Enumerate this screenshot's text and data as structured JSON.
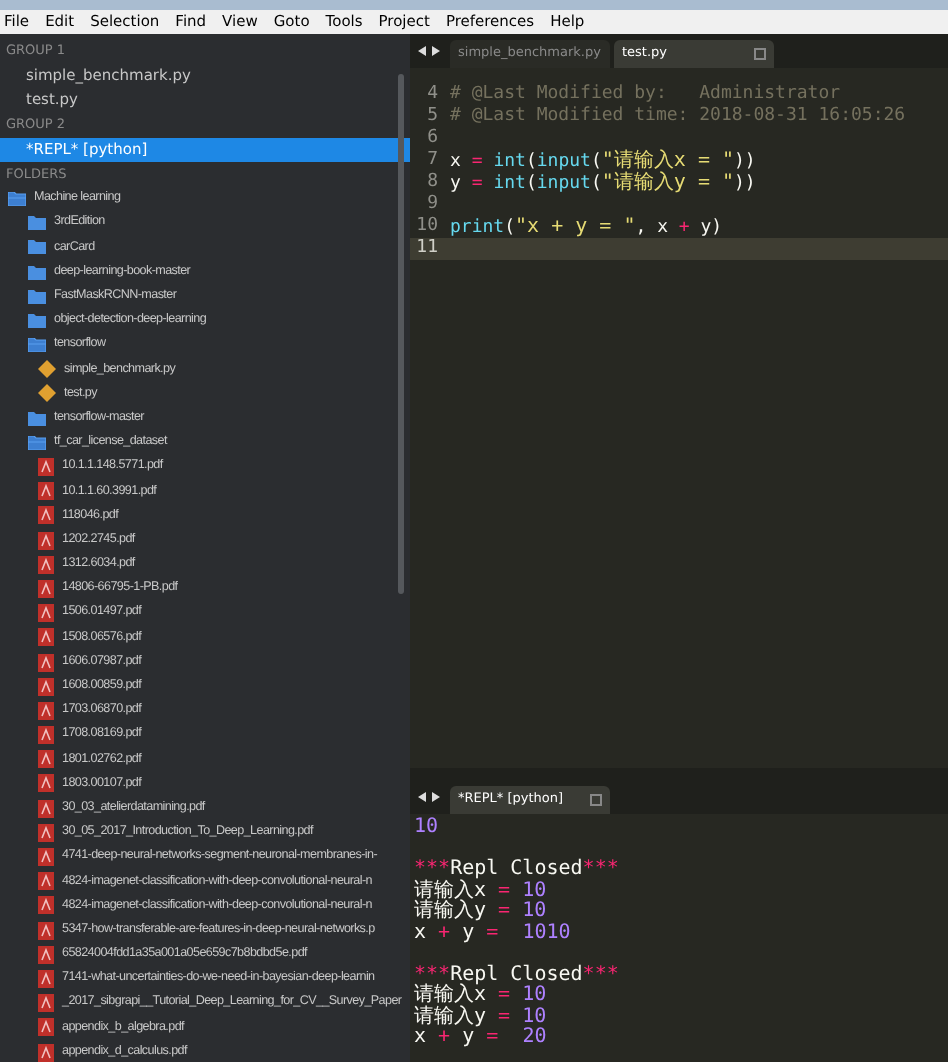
{
  "menu": [
    "File",
    "Edit",
    "Selection",
    "Find",
    "View",
    "Goto",
    "Tools",
    "Project",
    "Preferences",
    "Help"
  ],
  "sidebar": {
    "groups": [
      {
        "label": "GROUP 1",
        "files": [
          {
            "name": "simple_benchmark.py",
            "selected": false
          },
          {
            "name": "test.py",
            "selected": false
          }
        ]
      },
      {
        "label": "GROUP 2",
        "files": [
          {
            "name": "*REPL* [python]",
            "selected": true
          }
        ]
      }
    ],
    "folders_label": "FOLDERS",
    "tree": [
      {
        "name": "Machine learning",
        "kind": "folder",
        "expanded": true,
        "children": [
          {
            "name": "3rdEdition",
            "kind": "folder",
            "expanded": false
          },
          {
            "name": "carCard",
            "kind": "folder",
            "expanded": false
          },
          {
            "name": "deep-learning-book-master",
            "kind": "folder",
            "expanded": false
          },
          {
            "name": "FastMaskRCNN-master",
            "kind": "folder",
            "expanded": false
          },
          {
            "name": "object-detection-deep-learning",
            "kind": "folder",
            "expanded": false
          },
          {
            "name": "tensorflow",
            "kind": "folder",
            "expanded": true,
            "children": [
              {
                "name": "simple_benchmark.py",
                "kind": "py"
              },
              {
                "name": "test.py",
                "kind": "py"
              }
            ]
          },
          {
            "name": "tensorflow-master",
            "kind": "folder",
            "expanded": false
          },
          {
            "name": "tf_car_license_dataset",
            "kind": "folder",
            "expanded": true,
            "children": [
              {
                "name": "10.1.1.148.5771.pdf",
                "kind": "pdf"
              },
              {
                "name": "10.1.1.60.3991.pdf",
                "kind": "pdf"
              },
              {
                "name": "118046.pdf",
                "kind": "pdf"
              },
              {
                "name": "1202.2745.pdf",
                "kind": "pdf"
              },
              {
                "name": "1312.6034.pdf",
                "kind": "pdf"
              },
              {
                "name": "14806-66795-1-PB.pdf",
                "kind": "pdf"
              },
              {
                "name": "1506.01497.pdf",
                "kind": "pdf"
              },
              {
                "name": "1508.06576.pdf",
                "kind": "pdf"
              },
              {
                "name": "1606.07987.pdf",
                "kind": "pdf"
              },
              {
                "name": "1608.00859.pdf",
                "kind": "pdf"
              },
              {
                "name": "1703.06870.pdf",
                "kind": "pdf"
              },
              {
                "name": "1708.08169.pdf",
                "kind": "pdf"
              },
              {
                "name": "1801.02762.pdf",
                "kind": "pdf"
              },
              {
                "name": "1803.00107.pdf",
                "kind": "pdf"
              },
              {
                "name": "30_03_atelierdatamining.pdf",
                "kind": "pdf"
              },
              {
                "name": "30_05_2017_Introduction_To_Deep_Learning.pdf",
                "kind": "pdf"
              },
              {
                "name": "4741-deep-neural-networks-segment-neuronal-membranes-in-",
                "kind": "pdf"
              },
              {
                "name": "4824-imagenet-classification-with-deep-convolutional-neural-n",
                "kind": "pdf"
              },
              {
                "name": "4824-imagenet-classification-with-deep-convolutional-neural-n",
                "kind": "pdf"
              },
              {
                "name": "5347-how-transferable-are-features-in-deep-neural-networks.p",
                "kind": "pdf"
              },
              {
                "name": "65824004fdd1a35a001a05e659c7b8bdbd5e.pdf",
                "kind": "pdf"
              },
              {
                "name": "7141-what-uncertainties-do-we-need-in-bayesian-deep-learnin",
                "kind": "pdf"
              },
              {
                "name": "_2017_sibgrapi__Tutorial_Deep_Learning_for_CV__Survey_Paper",
                "kind": "pdf"
              },
              {
                "name": "appendix_b_algebra.pdf",
                "kind": "pdf"
              },
              {
                "name": "appendix_d_calculus.pdf",
                "kind": "pdf"
              }
            ]
          }
        ]
      }
    ]
  },
  "editor": {
    "tabs": [
      {
        "label": "simple_benchmark.py",
        "selected": false
      },
      {
        "label": "test.py",
        "selected": true
      }
    ],
    "lines": [
      {
        "number": "4",
        "current": false,
        "tokens": [
          {
            "kind": "comment",
            "text": "# @Last Modified by:   Administrator"
          }
        ]
      },
      {
        "number": "5",
        "current": false,
        "tokens": [
          {
            "kind": "comment",
            "text": "# @Last Modified time: 2018-08-31 16:05:26"
          }
        ]
      },
      {
        "number": "6",
        "current": false
      },
      {
        "number": "7",
        "current": false,
        "tokens": [
          {
            "kind": "plain",
            "text": "x "
          },
          {
            "kind": "operator",
            "text": "= "
          },
          {
            "kind": "builtin",
            "text": "int"
          },
          {
            "kind": "plain",
            "text": "("
          },
          {
            "kind": "builtin",
            "text": "input"
          },
          {
            "kind": "plain",
            "text": "("
          },
          {
            "kind": "string",
            "text": "\"请输入x = \""
          },
          {
            "kind": "plain",
            "text": "))"
          }
        ]
      },
      {
        "number": "8",
        "current": false,
        "tokens": [
          {
            "kind": "plain",
            "text": "y "
          },
          {
            "kind": "operator",
            "text": "= "
          },
          {
            "kind": "builtin",
            "text": "int"
          },
          {
            "kind": "plain",
            "text": "("
          },
          {
            "kind": "builtin",
            "text": "input"
          },
          {
            "kind": "plain",
            "text": "("
          },
          {
            "kind": "string",
            "text": "\"请输入y = \""
          },
          {
            "kind": "plain",
            "text": "))"
          }
        ]
      },
      {
        "number": "9",
        "current": false
      },
      {
        "number": "10",
        "current": false,
        "tokens": [
          {
            "kind": "builtin",
            "text": "print"
          },
          {
            "kind": "plain",
            "text": "("
          },
          {
            "kind": "string",
            "text": "\"x + y = \""
          },
          {
            "kind": "plain",
            "text": ", x "
          },
          {
            "kind": "operator",
            "text": "+ "
          },
          {
            "kind": "plain",
            "text": "y)"
          }
        ]
      },
      {
        "number": "11",
        "current": true
      }
    ]
  },
  "repl": {
    "tabs": [
      {
        "label": "*REPL* [python]",
        "selected": true
      }
    ],
    "lines": [
      {
        "kind": "output",
        "tokens": [
          {
            "kind": "number",
            "text": "10"
          }
        ]
      },
      {
        "kind": "banner",
        "tokens": [
          {
            "kind": "operator",
            "text": "***"
          },
          {
            "kind": "plain",
            "text": "Repl Closed"
          },
          {
            "kind": "operator",
            "text": "***"
          }
        ]
      },
      {
        "tokens": [
          {
            "kind": "plain",
            "text": "请输入x "
          },
          {
            "kind": "operator",
            "text": "= "
          },
          {
            "kind": "number",
            "text": "10"
          }
        ]
      },
      {
        "tokens": [
          {
            "kind": "plain",
            "text": "请输入y "
          },
          {
            "kind": "operator",
            "text": "= "
          },
          {
            "kind": "number",
            "text": "10"
          }
        ]
      },
      {
        "kind": "output",
        "tokens": [
          {
            "kind": "plain",
            "text": "x "
          },
          {
            "kind": "operator",
            "text": "+ "
          },
          {
            "kind": "plain",
            "text": "y "
          },
          {
            "kind": "operator",
            "text": "=  "
          },
          {
            "kind": "number",
            "text": "1010"
          }
        ]
      },
      {
        "kind": "banner",
        "tokens": [
          {
            "kind": "operator",
            "text": "***"
          },
          {
            "kind": "plain",
            "text": "Repl Closed"
          },
          {
            "kind": "operator",
            "text": "***"
          }
        ]
      },
      {
        "tokens": [
          {
            "kind": "plain",
            "text": "请输入x "
          },
          {
            "kind": "operator",
            "text": "= "
          },
          {
            "kind": "number",
            "text": "10"
          }
        ]
      },
      {
        "tokens": [
          {
            "kind": "plain",
            "text": "请输入y "
          },
          {
            "kind": "operator",
            "text": "= "
          },
          {
            "kind": "number",
            "text": "10"
          }
        ]
      },
      {
        "tokens": [
          {
            "kind": "plain",
            "text": "x "
          },
          {
            "kind": "operator",
            "text": "+ "
          },
          {
            "kind": "plain",
            "text": "y "
          },
          {
            "kind": "operator",
            "text": "=  "
          },
          {
            "kind": "number",
            "text": "20"
          }
        ]
      }
    ]
  }
}
